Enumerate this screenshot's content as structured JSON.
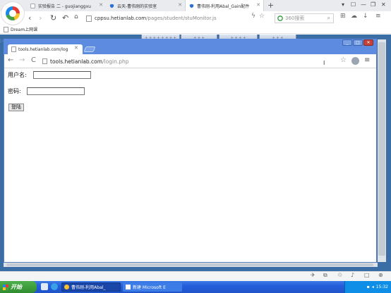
{
  "outer_browser": {
    "tabs": [
      {
        "title": "实验报告 二 - guojianggxu",
        "active": false
      },
      {
        "title": "云天-曹伟刚的实验室",
        "active": false
      },
      {
        "title": "曹伟刚-利用Abal_Gain配件",
        "active": true
      }
    ],
    "new_tab_symbol": "+",
    "url_domain": "cppsu.hetianlab.com",
    "url_path": "/pages/student/stuMonitor.js",
    "search_placeholder": "360搜索",
    "bookmark_label": "Dream上网课"
  },
  "remote_toolbar": [
    "+ + + + + + + +",
    "+ + +",
    "+ + + +",
    "+ + +"
  ],
  "chrome": {
    "tab_title": "tools.hetianlab.com/log",
    "url_domain": "tools.hetianlab.com",
    "url_path": "/login.php",
    "window_controls": [
      "_",
      "□",
      "✕"
    ]
  },
  "login_form": {
    "username_label": "用户名:",
    "username_value": "",
    "password_label": "密码:",
    "password_value": "",
    "submit_label": "登陆"
  },
  "taskbar": {
    "start_label": "开始",
    "tasks": [
      {
        "title": "曹伟刚-利用Abal_",
        "active": true
      },
      {
        "title": "新建 Microsoft E",
        "active": false
      }
    ],
    "clock": "15:32"
  },
  "colors": {
    "chrome_frame": "#5d8be0",
    "taskbar": "#245edb",
    "start_button": "#2f8c2f"
  }
}
